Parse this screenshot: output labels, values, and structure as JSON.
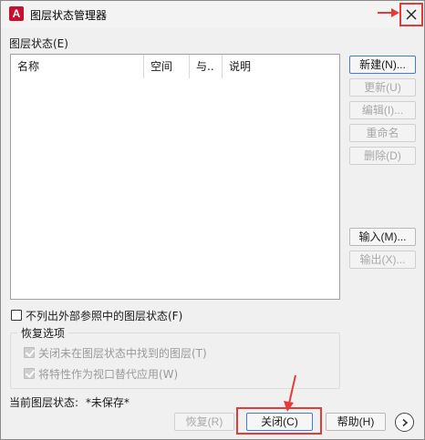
{
  "window": {
    "title": "图层状态管理器",
    "icon_letter": "A",
    "icon_color": "#c8102e"
  },
  "section_layer_states": "图层状态(E)",
  "table": {
    "columns": [
      "名称",
      "空间",
      "与..",
      "说明"
    ],
    "rows": []
  },
  "side_buttons": {
    "new": "新建(N)...",
    "update": "更新(U)",
    "edit": "编辑(I)...",
    "rename": "重命名",
    "delete": "删除(D)",
    "import": "输入(M)...",
    "export": "输出(X)..."
  },
  "options": {
    "dont_list_xref": "不列出外部参照中的图层状态(F)",
    "restore_group_title": "恢复选项",
    "turn_off_layers": "关闭未在图层状态中找到的图层(T)",
    "apply_as_viewport_override": "将特性作为视口替代应用(W)"
  },
  "status": {
    "current_label": "当前图层状态:",
    "current_value": "*未保存*"
  },
  "bottom_buttons": {
    "restore": "恢复(R)",
    "close": "关闭(C)",
    "help": "帮助(H)"
  },
  "annotation_color": "#e23b3b"
}
